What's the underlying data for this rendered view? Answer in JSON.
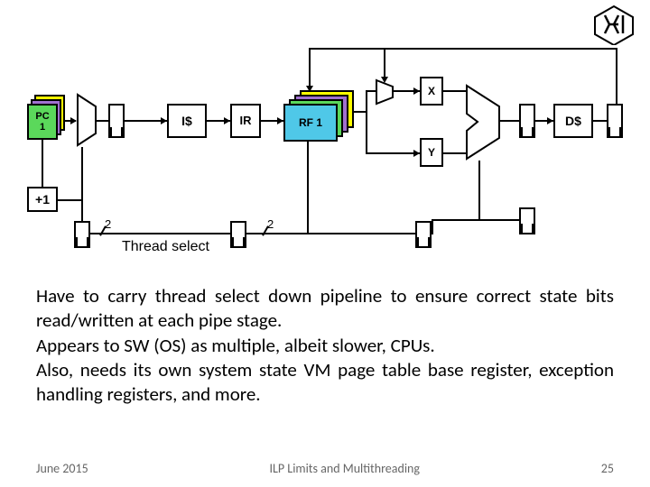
{
  "diagram": {
    "pc": "PC",
    "pc_sub": "1",
    "icache": "I$",
    "ir": "IR",
    "rf": "RF 1",
    "x": "X",
    "y": "Y",
    "dcache": "D$",
    "plus1": "+1",
    "thread_select": "Thread select",
    "bus_width": "2"
  },
  "body": {
    "p1": "Have to carry thread select down pipeline to ensure correct state bits read/written at each pipe stage.",
    "p2": "Appears to SW (OS) as multiple, albeit slower, CPUs.",
    "p3": "Also, needs its own system state VM page table base register, exception handling registers, and more."
  },
  "footer": {
    "date": "June 2015",
    "title": "ILP Limits and Multithreading",
    "page": "25"
  }
}
